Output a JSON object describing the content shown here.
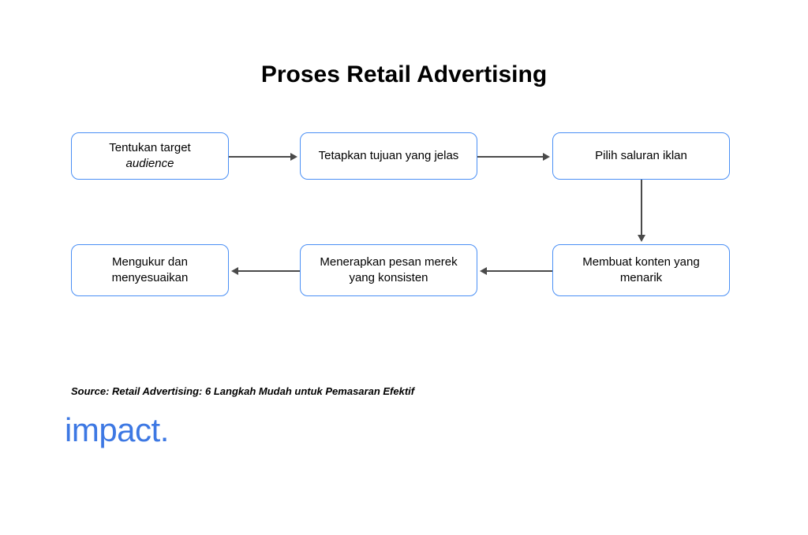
{
  "title": "Proses Retail Advertising",
  "boxes": {
    "box1_line1": "Tentukan target",
    "box1_line2": "audience",
    "box2": "Tetapkan tujuan yang jelas",
    "box3": "Pilih saluran iklan",
    "box4_line1": "Membuat konten yang",
    "box4_line2": "menarik",
    "box5_line1": "Menerapkan pesan merek",
    "box5_line2": "yang konsisten",
    "box6_line1": "Mengukur dan",
    "box6_line2": "menyesuaikan"
  },
  "source": "Source: Retail Advertising: 6 Langkah Mudah untuk Pemasaran Efektif",
  "logo": "impact."
}
